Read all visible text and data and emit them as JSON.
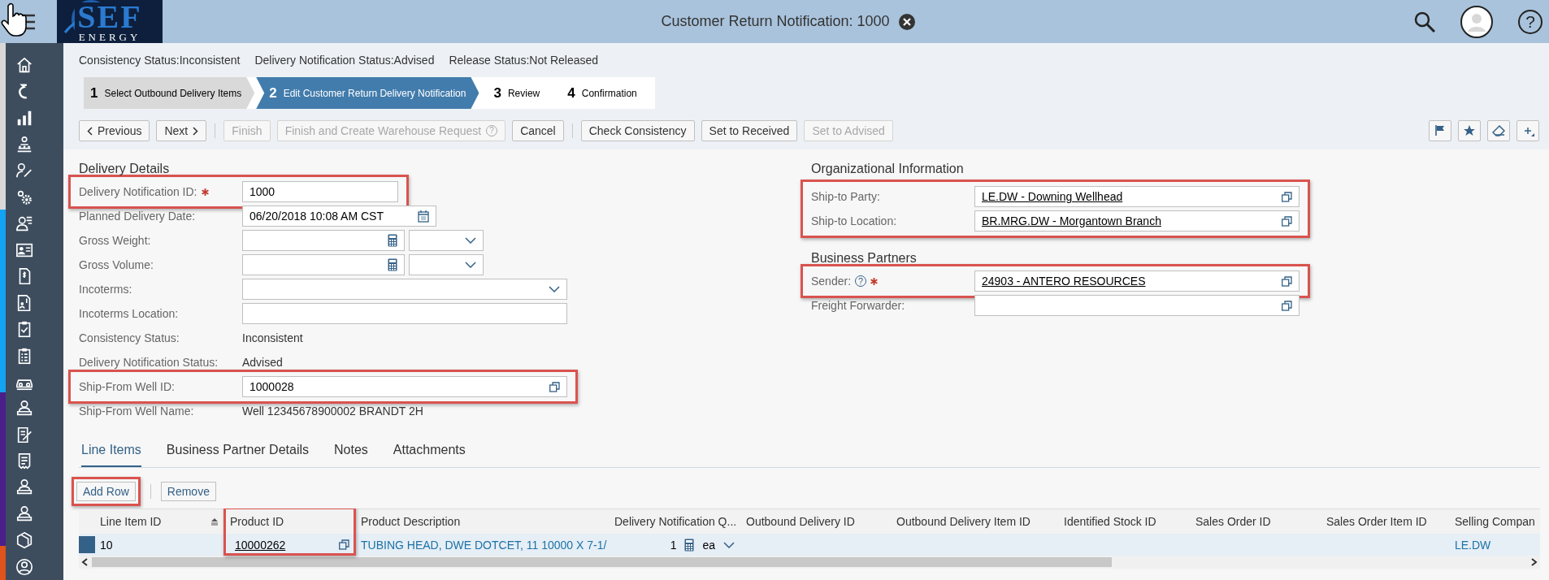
{
  "header": {
    "logo": {
      "name": "SEF",
      "tagline": "ENERGY"
    },
    "title": "Customer Return Notification: 1000",
    "help": "?"
  },
  "status_line": [
    {
      "label": "Consistency Status:",
      "value": "Inconsistent"
    },
    {
      "label": "Delivery Notification Status:",
      "value": "Advised"
    },
    {
      "label": "Release Status:",
      "value": "Not Released"
    }
  ],
  "wizard": [
    {
      "number": "1",
      "label": "Select Outbound Delivery Items",
      "selected": false,
      "completed": true
    },
    {
      "number": "2",
      "label": "Edit Customer Return Delivery Notification",
      "selected": true,
      "completed": false
    },
    {
      "number": "3",
      "label": "Review",
      "selected": false,
      "completed": false
    },
    {
      "number": "4",
      "label": "Confirmation",
      "selected": false,
      "completed": false
    }
  ],
  "toolbar": {
    "groups": [
      [
        {
          "label": "Previous",
          "kind": "back",
          "disabled": false
        },
        {
          "label": "Next",
          "kind": "forward",
          "disabled": false
        }
      ],
      [
        {
          "label": "Finish",
          "disabled": true
        },
        {
          "label": "Finish and Create Warehouse Request",
          "help": "?",
          "disabled": true
        },
        {
          "label": "Cancel",
          "disabled": false
        }
      ],
      [
        {
          "label": "Check Consistency",
          "disabled": false
        },
        {
          "label": "Set to Received",
          "disabled": false
        },
        {
          "label": "Set to Advised",
          "disabled": true
        }
      ]
    ]
  },
  "columns": [
    [
      {
        "title": "Delivery Details",
        "highlighted": false,
        "fields": [
          {
            "label": "Delivery Notification ID:",
            "kind": "id_input",
            "value": "1000",
            "required": true,
            "highlighted": true
          },
          {
            "label": "Planned Delivery Date:",
            "kind": "date",
            "value": "06/20/2018 10:08 AM CST",
            "required": false,
            "highlighted": false
          },
          {
            "label": "Gross Weight:",
            "kind": "quantity",
            "required": false,
            "highlighted": false
          },
          {
            "label": "Gross Volume:",
            "kind": "quantity",
            "required": false,
            "highlighted": false
          },
          {
            "label": "Incoterms:",
            "kind": "dropdown",
            "required": false,
            "highlighted": false
          },
          {
            "label": "Incoterms Location:",
            "kind": "input",
            "required": false,
            "highlighted": false
          },
          {
            "label": "Consistency Status:",
            "kind": "text",
            "value": "Inconsistent",
            "required": false,
            "highlighted": false
          },
          {
            "label": "Delivery Notification Status:",
            "kind": "text",
            "value": "Advised",
            "required": false,
            "highlighted": false
          },
          {
            "label": "Ship-From Well ID:",
            "kind": "value_help",
            "value": "1000028",
            "link": false,
            "required": false,
            "highlighted": true
          },
          {
            "label": "Ship-From Well Name:",
            "kind": "text",
            "value": "Well 12345678900002 BRANDT 2H",
            "required": false,
            "highlighted": false
          }
        ]
      }
    ],
    [
      {
        "title": "Organizational Information",
        "highlighted": true,
        "fields": [
          {
            "label": "Ship-to Party:",
            "kind": "value_help",
            "value": "LE.DW - Downing Wellhead",
            "link": true,
            "required": false,
            "highlighted": false
          },
          {
            "label": "Ship-to Location:",
            "kind": "value_help",
            "value": "BR.MRG.DW - Morgantown Branch",
            "link": true,
            "required": false,
            "highlighted": false
          }
        ]
      },
      {
        "title": "Business Partners",
        "highlighted": false,
        "fields": [
          {
            "label": "Sender:",
            "help": "?",
            "kind": "value_help",
            "value": "24903 - ANTERO RESOURCES",
            "link": true,
            "required": true,
            "highlighted": true
          },
          {
            "label": "Freight Forwarder:",
            "kind": "value_help",
            "required": false,
            "highlighted": false
          }
        ]
      }
    ]
  ],
  "tabs": [
    {
      "label": "Line Items",
      "selected": true
    },
    {
      "label": "Business Partner Details",
      "selected": false
    },
    {
      "label": "Notes",
      "selected": false
    },
    {
      "label": "Attachments",
      "selected": false
    }
  ],
  "table_toolbar": [
    {
      "label": "Add Row",
      "highlighted": true
    },
    {
      "label": "Remove",
      "highlighted": false
    }
  ],
  "table": {
    "columns": [
      {
        "label": "Line Item ID",
        "sorted": true,
        "highlighted": false
      },
      {
        "label": "Product ID",
        "sorted": false,
        "highlighted": true
      },
      {
        "label": "Product Description",
        "sorted": false,
        "highlighted": false
      },
      {
        "label": "Delivery Notification Q...",
        "sorted": false,
        "highlighted": false
      },
      {
        "label": "Outbound Delivery ID",
        "sorted": false,
        "highlighted": false
      },
      {
        "label": "Outbound Delivery Item ID",
        "sorted": false,
        "highlighted": false
      },
      {
        "label": "Identified Stock ID",
        "sorted": false,
        "highlighted": false
      },
      {
        "label": "Sales Order ID",
        "sorted": false,
        "highlighted": false
      },
      {
        "label": "Sales Order Item ID",
        "sorted": false,
        "highlighted": false
      },
      {
        "label": "Selling Compan",
        "sorted": false,
        "highlighted": false
      }
    ],
    "rows": [
      {
        "selected": true,
        "cells": [
          {
            "kind": "text",
            "value": "10"
          },
          {
            "kind": "link_help",
            "value": "10000262"
          },
          {
            "kind": "link",
            "value": "TUBING HEAD, DWE DOTCET, 11 10000 X 7-1/"
          },
          {
            "kind": "quantity",
            "value": "1",
            "unit": "ea"
          },
          {
            "kind": "empty"
          },
          {
            "kind": "empty"
          },
          {
            "kind": "empty"
          },
          {
            "kind": "empty"
          },
          {
            "kind": "empty"
          },
          {
            "kind": "link",
            "value": "LE.DW"
          }
        ]
      }
    ]
  }
}
